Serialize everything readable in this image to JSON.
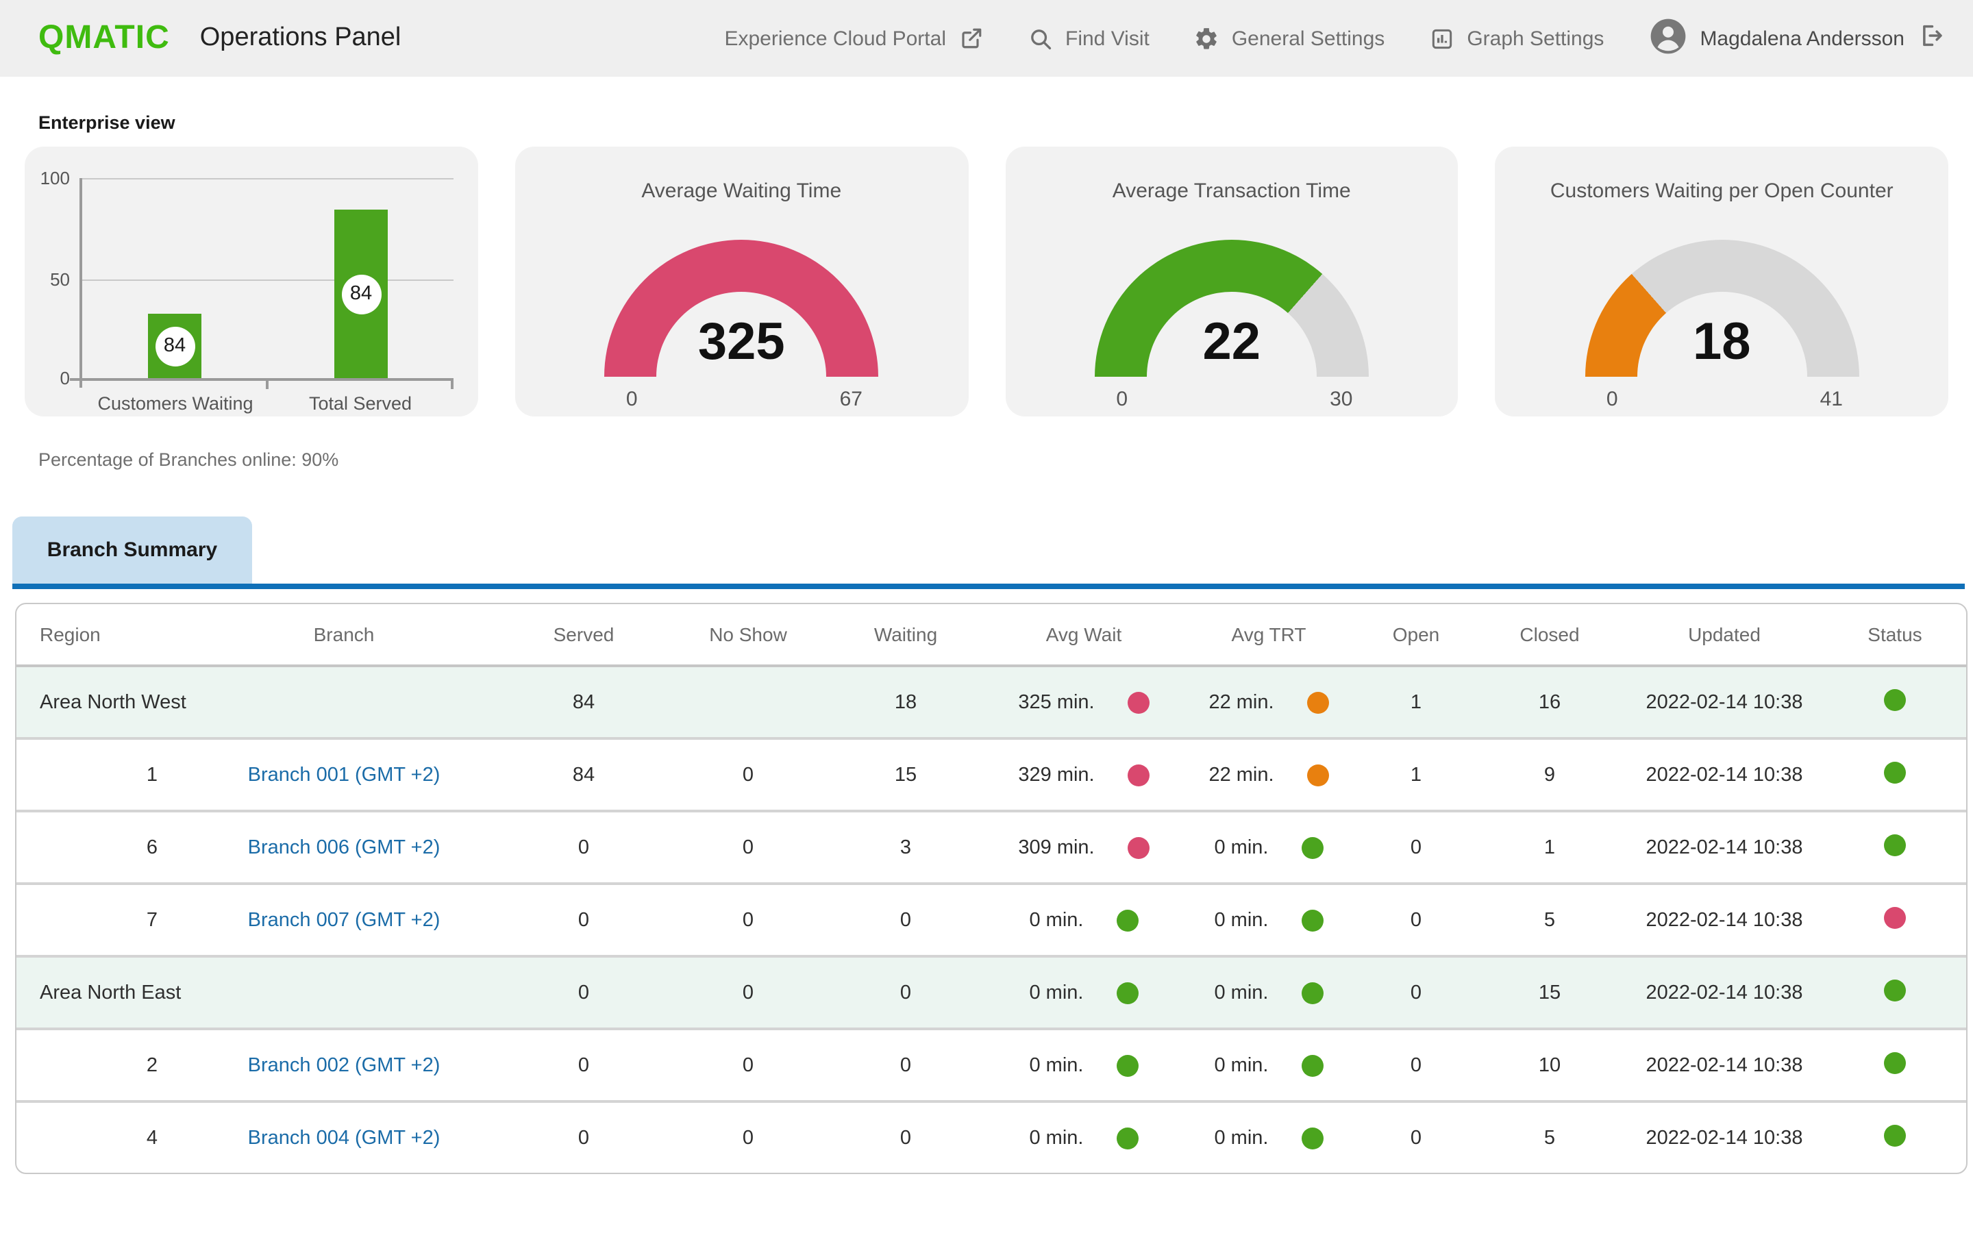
{
  "header": {
    "brand": "QMATIC",
    "title": "Operations Panel",
    "nav": [
      {
        "label": "Experience Cloud Portal",
        "icon": "external-link-icon"
      },
      {
        "label": "Find Visit",
        "icon": "search-icon"
      },
      {
        "label": "General Settings",
        "icon": "gear-icon"
      },
      {
        "label": "Graph Settings",
        "icon": "bar-chart-icon"
      }
    ],
    "user": {
      "name": "Magdalena Andersson",
      "avatar_icon": "person-circle-icon",
      "logout_icon": "logout-icon"
    }
  },
  "enterprise": {
    "section_label": "Enterprise view",
    "branches_online_text": "Percentage of Branches online: 90%"
  },
  "chart_data": [
    {
      "type": "bar",
      "categories": [
        "Customers Waiting",
        "Total Served"
      ],
      "values": [
        32,
        84
      ],
      "data_labels": [
        "84",
        "84"
      ],
      "title": "",
      "xlabel": "",
      "ylabel": "",
      "ylim": [
        0,
        100
      ],
      "yticks": [
        0,
        50,
        100
      ],
      "grid": true,
      "bar_color": "#4BA41E"
    },
    {
      "type": "gauge",
      "title": "Average Waiting Time",
      "value": 325,
      "min": 0,
      "max": 67,
      "color": "#D9486E",
      "track_color": "#D8D8D8",
      "fill_fraction": 1
    },
    {
      "type": "gauge",
      "title": "Average Transaction Time",
      "value": 22,
      "min": 0,
      "max": 30,
      "color": "#4BA41E",
      "track_color": "#D8D8D8",
      "fill_fraction": 0.73
    },
    {
      "type": "gauge",
      "title": "Customers Waiting per Open Counter",
      "value": 18,
      "min": 0,
      "max": 41,
      "color": "#E8800F",
      "track_color": "#D8D8D8",
      "fill_fraction": 0.27
    }
  ],
  "tabs": {
    "branch_summary": "Branch Summary"
  },
  "table": {
    "columns": [
      "Region",
      "Branch",
      "Served",
      "No Show",
      "Waiting",
      "Avg Wait",
      "Avg TRT",
      "Open",
      "Closed",
      "Updated",
      "Status"
    ],
    "rows": [
      {
        "type": "region",
        "region": "Area North West",
        "index": "",
        "branch": "",
        "served": "84",
        "no_show": "",
        "waiting": "18",
        "avg_wait": "325 min.",
        "avg_wait_color": "pink",
        "avg_trt": "22 min.",
        "avg_trt_color": "orange",
        "open": "1",
        "closed": "16",
        "updated": "2022-02-14 10:38",
        "status": "green"
      },
      {
        "type": "branch",
        "region": "",
        "index": "1",
        "branch": "Branch 001 (GMT +2)",
        "served": "84",
        "no_show": "0",
        "waiting": "15",
        "avg_wait": "329 min.",
        "avg_wait_color": "pink",
        "avg_trt": "22 min.",
        "avg_trt_color": "orange",
        "open": "1",
        "closed": "9",
        "updated": "2022-02-14 10:38",
        "status": "green"
      },
      {
        "type": "branch",
        "region": "",
        "index": "6",
        "branch": "Branch 006 (GMT +2)",
        "served": "0",
        "no_show": "0",
        "waiting": "3",
        "avg_wait": "309 min.",
        "avg_wait_color": "pink",
        "avg_trt": "0 min.",
        "avg_trt_color": "green",
        "open": "0",
        "closed": "1",
        "updated": "2022-02-14 10:38",
        "status": "green"
      },
      {
        "type": "branch",
        "region": "",
        "index": "7",
        "branch": "Branch 007 (GMT +2)",
        "served": "0",
        "no_show": "0",
        "waiting": "0",
        "avg_wait": "0 min.",
        "avg_wait_color": "green",
        "avg_trt": "0 min.",
        "avg_trt_color": "green",
        "open": "0",
        "closed": "5",
        "updated": "2022-02-14 10:38",
        "status": "pink"
      },
      {
        "type": "region",
        "region": "Area North East",
        "index": "",
        "branch": "",
        "served": "0",
        "no_show": "0",
        "waiting": "0",
        "avg_wait": "0 min.",
        "avg_wait_color": "green",
        "avg_trt": "0 min.",
        "avg_trt_color": "green",
        "open": "0",
        "closed": "15",
        "updated": "2022-02-14 10:38",
        "status": "green"
      },
      {
        "type": "branch",
        "region": "",
        "index": "2",
        "branch": "Branch 002 (GMT +2)",
        "served": "0",
        "no_show": "0",
        "waiting": "0",
        "avg_wait": "0 min.",
        "avg_wait_color": "green",
        "avg_trt": "0 min.",
        "avg_trt_color": "green",
        "open": "0",
        "closed": "10",
        "updated": "2022-02-14 10:38",
        "status": "green"
      },
      {
        "type": "branch",
        "region": "",
        "index": "4",
        "branch": "Branch 004 (GMT +2)",
        "served": "0",
        "no_show": "0",
        "waiting": "0",
        "avg_wait": "0 min.",
        "avg_wait_color": "green",
        "avg_trt": "0 min.",
        "avg_trt_color": "green",
        "open": "0",
        "closed": "5",
        "updated": "2022-02-14 10:38",
        "status": "green"
      }
    ]
  },
  "colors": {
    "green": "#4BA41E",
    "pink": "#D9486E",
    "orange": "#E8800F",
    "logo_green": "#3FBB0F",
    "link_blue": "#1B6CA8",
    "tab_blue_bg": "#C8DFF0",
    "tab_underline_blue": "#1070B8",
    "region_row_bg": "#ECF5F1",
    "gauge_track_gray": "#D8D8D8"
  }
}
